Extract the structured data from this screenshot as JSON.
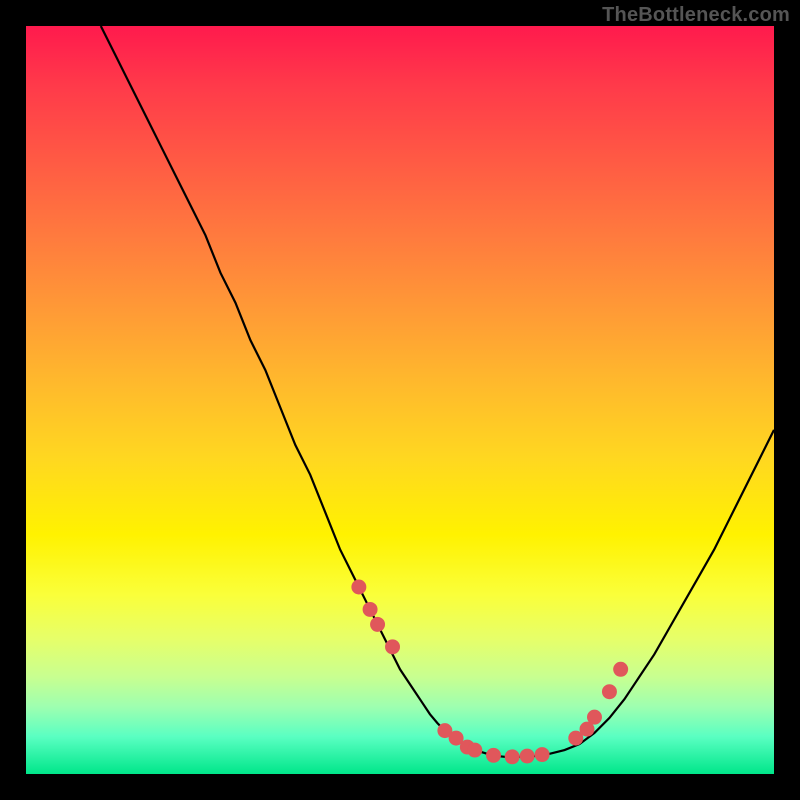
{
  "watermark": "TheBottleneck.com",
  "chart_data": {
    "type": "line",
    "title": "",
    "xlabel": "",
    "ylabel": "",
    "xlim": [
      0,
      100
    ],
    "ylim": [
      0,
      100
    ],
    "grid": false,
    "series": [
      {
        "name": "curve",
        "color": "#000000",
        "x": [
          10,
          12,
          14,
          16,
          18,
          20,
          22,
          24,
          26,
          28,
          30,
          32,
          34,
          36,
          38,
          40,
          42,
          44,
          46,
          48,
          50,
          52,
          53,
          54,
          55,
          56,
          58,
          60,
          62,
          63,
          64,
          66,
          68,
          70,
          72,
          74,
          76,
          78,
          80,
          82,
          84,
          86,
          88,
          90,
          92,
          94,
          96,
          98,
          100
        ],
        "y": [
          100,
          96,
          92,
          88,
          84,
          80,
          76,
          72,
          67,
          63,
          58,
          54,
          49,
          44,
          40,
          35,
          30,
          26,
          22,
          18,
          14,
          11,
          9.5,
          8.0,
          6.8,
          5.8,
          4.2,
          3.2,
          2.6,
          2.4,
          2.3,
          2.3,
          2.4,
          2.7,
          3.2,
          4.0,
          5.5,
          7.5,
          10,
          13,
          16,
          19.5,
          23,
          26.5,
          30,
          34,
          38,
          42,
          46
        ]
      }
    ],
    "markers": {
      "name": "points",
      "color": "#e0575b",
      "radius_units": 1.0,
      "x": [
        44.5,
        46.0,
        47.0,
        49.0,
        56.0,
        57.5,
        59.0,
        60.0,
        62.5,
        65.0,
        67.0,
        69.0,
        73.5,
        75.0,
        76.0,
        78.0,
        79.5
      ],
      "y": [
        25.0,
        22.0,
        20.0,
        17.0,
        5.8,
        4.8,
        3.6,
        3.2,
        2.5,
        2.3,
        2.4,
        2.6,
        4.8,
        6.0,
        7.6,
        11.0,
        14.0
      ]
    }
  }
}
